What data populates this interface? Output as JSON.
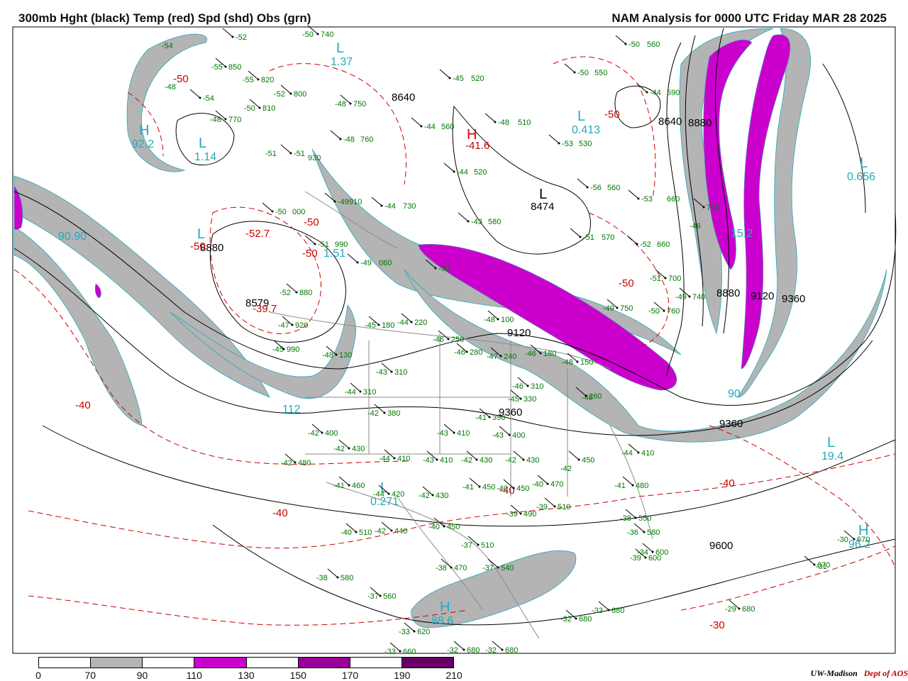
{
  "header": {
    "title": "300mb Hght (black) Temp (red) Spd (shd) Obs (grn)",
    "valid": "NAM Analysis for 0000 UTC Friday  MAR 28 2025"
  },
  "legend": {
    "ticks": [
      "0",
      "70",
      "90",
      "110",
      "130",
      "150",
      "170",
      "190",
      "210"
    ],
    "fills": [
      "#ffffff",
      "#b4b4b4",
      "#ffffff",
      "#cc00cc",
      "#ffffff",
      "#990099",
      "#ffffff",
      "#660066"
    ]
  },
  "credit": {
    "org": "UW-Madison",
    "dept": "Dept of AOS"
  },
  "colors": {
    "height": "#000000",
    "temp": "#cc0000",
    "speed_label": "#22aabb",
    "obs": "#007700",
    "border": "#888888"
  },
  "height_labels": [
    "8640",
    "8640",
    "8880",
    "9120",
    "8474",
    "8880",
    "8579",
    "9120",
    "9360",
    "9360",
    "9360",
    "9600",
    "8880"
  ],
  "temp_labels": [
    "-50",
    "-52.7",
    "-50",
    "-50",
    "-50",
    "-39.7",
    "-40",
    "-40",
    "-40",
    "-40",
    "-30",
    "-41.6",
    "-50",
    "-50"
  ],
  "speed_labels": [
    "1.37",
    "92.2",
    "1.14",
    "0.413",
    "0.656",
    "15.2",
    "90.90",
    "1.51",
    "112",
    "19.4",
    "0.271",
    "88.6",
    "96.2",
    "90"
  ],
  "extrema_letters": [
    "L",
    "H",
    "L",
    "L",
    "L",
    "L",
    "L",
    "H",
    "L",
    "L",
    "H",
    "H"
  ],
  "station_obs": [
    "-54",
    "-52",
    "-50",
    "740",
    "-55",
    "850",
    "-55",
    "820",
    "-48",
    "-54",
    "-52",
    "800",
    "-48",
    "750",
    "-48",
    "770",
    "-50",
    "810",
    "-51",
    "-51",
    "930",
    "-48",
    "760",
    "-44",
    "560",
    "-48",
    "510",
    "-45",
    "520",
    "-44",
    "520",
    "-53",
    "530",
    "-56",
    "560",
    "-53",
    "660",
    "-44",
    "590",
    "-50",
    "560",
    "-50",
    "550",
    "-44",
    "730",
    "-49",
    "910",
    "-43",
    "580",
    "-51",
    "570",
    "-52",
    "660",
    "-50",
    "000",
    "-51",
    "990",
    "-49",
    "060",
    "-50",
    "-46",
    "750",
    "-52",
    "880",
    "-47",
    "920",
    "-45",
    "990",
    "-48",
    "130",
    "-45",
    "180",
    "-44",
    "220",
    "-48",
    "100",
    "-51",
    "700",
    "-49",
    "740",
    "-49",
    "750",
    "-50",
    "760",
    "-46",
    "250",
    "-46",
    "280",
    "-47",
    "240",
    "-46",
    "180",
    "-48",
    "150",
    "-43",
    "310",
    "-44",
    "310",
    "-46",
    "310",
    "-45",
    "330",
    "-46",
    "260",
    "-42",
    "380",
    "-41",
    "390",
    "-43",
    "410",
    "-43",
    "400",
    "-42",
    "400",
    "-42",
    "430",
    "-42",
    "480",
    "-44",
    "410",
    "-43",
    "410",
    "-42",
    "430",
    "-42",
    "430",
    "-42",
    "450",
    "-44",
    "410",
    "-41",
    "460",
    "-44",
    "420",
    "-42",
    "430",
    "-41",
    "450",
    "-40",
    "450",
    "-40",
    "470",
    "-41",
    "480",
    "-39",
    "490",
    "-39",
    "510",
    "-38",
    "550",
    "-36",
    "580",
    "-34",
    "600",
    "-40",
    "450",
    "-42",
    "440",
    "-40",
    "510",
    "-37",
    "510",
    "-38",
    "470",
    "-37",
    "540",
    "-38",
    "580",
    "-37",
    "560",
    "-33",
    "620",
    "-33",
    "660",
    "-32",
    "680",
    "-32",
    "680",
    "-32",
    "680",
    "-33",
    "680",
    "-31",
    "670",
    "-30",
    "670",
    "-29",
    "680",
    "-39",
    "600"
  ]
}
